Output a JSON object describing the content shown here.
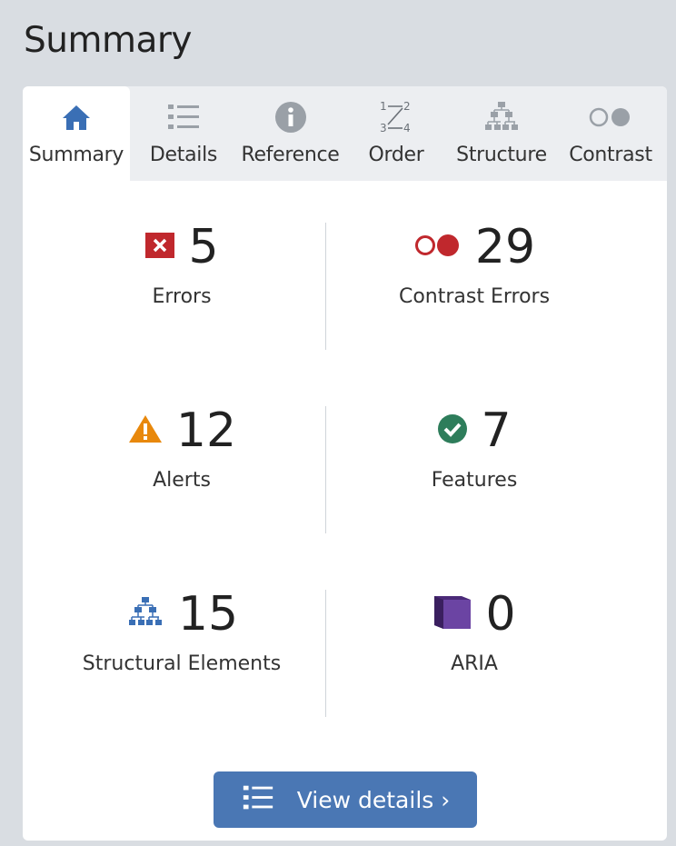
{
  "app": {
    "title": "Summary"
  },
  "tabs": [
    {
      "label": "Summary",
      "icon": "home-icon",
      "active": true
    },
    {
      "label": "Details",
      "icon": "list-icon"
    },
    {
      "label": "Reference",
      "icon": "info-icon"
    },
    {
      "label": "Order",
      "icon": "order-icon"
    },
    {
      "label": "Structure",
      "icon": "structure-icon"
    },
    {
      "label": "Contrast",
      "icon": "contrast-icon"
    }
  ],
  "stats": {
    "errors": {
      "count": "5",
      "label": "Errors",
      "icon": "error-icon",
      "color": "#c0282d"
    },
    "contrast_errors": {
      "count": "29",
      "label": "Contrast Errors",
      "icon": "contrast-error-icon",
      "color": "#c0282d"
    },
    "alerts": {
      "count": "12",
      "label": "Alerts",
      "icon": "alert-icon",
      "color": "#e8880c"
    },
    "features": {
      "count": "7",
      "label": "Features",
      "icon": "feature-icon",
      "color": "#2e7d5b"
    },
    "structural": {
      "count": "15",
      "label": "Structural Elements",
      "icon": "structure-icon",
      "color": "#3a6fb5"
    },
    "aria": {
      "count": "0",
      "label": "ARIA",
      "icon": "aria-icon",
      "color": "#4b2a78"
    }
  },
  "button": {
    "label": "View details ›",
    "icon": "list-icon"
  },
  "colors": {
    "accent": "#4a77b4",
    "tab_bar": "#eceef1",
    "background": "#d9dde2"
  }
}
